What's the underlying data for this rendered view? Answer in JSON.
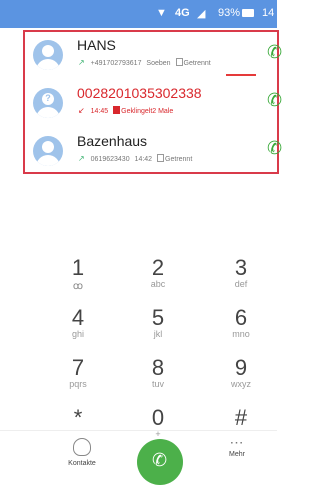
{
  "status": {
    "network": "4G",
    "battery": "93%",
    "time": "14"
  },
  "calls": [
    {
      "name": "HANS",
      "number": "+491702793617",
      "time": "Soeben",
      "sim": "Getrennt",
      "type": "outgoing"
    },
    {
      "name": "0028201035302338",
      "number": "",
      "time": "14:45",
      "sim": "Geklingelt2 Male",
      "type": "missed"
    },
    {
      "name": "Bazenhaus",
      "number": "0619623430",
      "time": "14:42",
      "sim": "Getrennt",
      "type": "outgoing"
    }
  ],
  "keypad": [
    {
      "num": "1",
      "sub": "voicemail"
    },
    {
      "num": "2",
      "sub": "abc"
    },
    {
      "num": "3",
      "sub": "def"
    },
    {
      "num": "4",
      "sub": "ghi"
    },
    {
      "num": "5",
      "sub": "jkl"
    },
    {
      "num": "6",
      "sub": "mno"
    },
    {
      "num": "7",
      "sub": "pqrs"
    },
    {
      "num": "8",
      "sub": "tuv"
    },
    {
      "num": "9",
      "sub": "wxyz"
    },
    {
      "num": "*",
      "sub": ""
    },
    {
      "num": "0",
      "sub": "+"
    },
    {
      "num": "#",
      "sub": ""
    }
  ],
  "bottom": {
    "contacts_label": "Kontakte",
    "more_label": "Mehr"
  },
  "colors": {
    "status_bar": "#5b94e1",
    "highlight_border": "#d93a4a",
    "missed": "#d9282d",
    "call_green": "#4cb04a"
  }
}
